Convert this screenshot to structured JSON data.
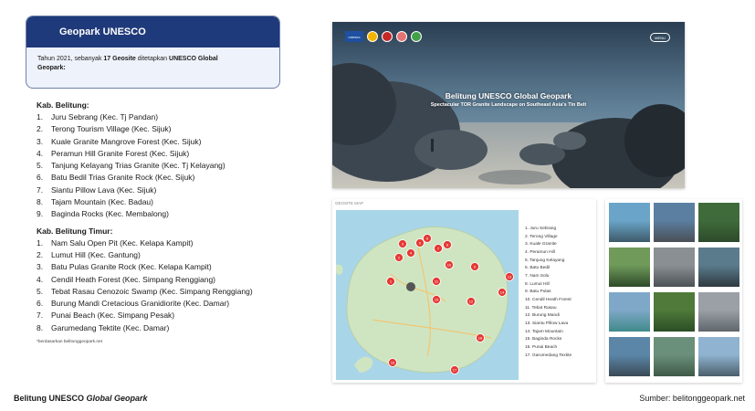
{
  "info_card": {
    "title": "Geopark UNESCO",
    "text_prefix": "Tahun 2021, sebanyak ",
    "text_bold_count": "17 Geosite",
    "text_mid": " ditetapkan ",
    "text_bold_org": "UNESCO Global",
    "text_line2": "Geopark:"
  },
  "groups": [
    {
      "title": "Kab. Belitung:",
      "items": [
        {
          "num": "1.",
          "label": "Juru Sebrang (Kec. Tj Pandan)"
        },
        {
          "num": "2.",
          "label": "Terong Tourism Village (Kec. Sijuk)"
        },
        {
          "num": "3.",
          "label": "Kuale Granite Mangrove Forest (Kec. Sijuk)"
        },
        {
          "num": "4.",
          "label": "Peramun Hill Granite Forest (Kec. Sijuk)"
        },
        {
          "num": "5.",
          "label": "Tanjung Kelayang Trias Granite (Kec. Tj Kelayang)"
        },
        {
          "num": "6.",
          "label": "Batu Bedil Trias Granite Rock (Kec. Sijuk)"
        },
        {
          "num": "7.",
          "label": "Siantu Pillow Lava (Kec. Sijuk)"
        },
        {
          "num": "8.",
          "label": "Tajam Mountain (Kec. Badau)"
        },
        {
          "num": "9.",
          "label": "Baginda Rocks (Kec. Membalong)"
        }
      ]
    },
    {
      "title": "Kab. Belitung Timur:",
      "items": [
        {
          "num": "1.",
          "label": "Nam Salu Open Pit (Kec. Kelapa Kampit)"
        },
        {
          "num": "2.",
          "label": "Lumut Hill (Kec. Gantung)"
        },
        {
          "num": "3.",
          "label": "Batu Pulas Granite Rock (Kec. Kelapa Kampit)"
        },
        {
          "num": "4.",
          "label": "Cendil Heath Forest (Kec. Simpang Renggiang)"
        },
        {
          "num": "5.",
          "label": "Tebat Rasau Cenozoic Swamp (Kec. Simpang Renggiang)"
        },
        {
          "num": "6.",
          "label": "Burung Mandi Cretacious Granidiorite (Kec. Damar)"
        },
        {
          "num": "7.",
          "label": "Punai Beach (Kec. Simpang Pesak)"
        },
        {
          "num": "8.",
          "label": "Garumedang Tektite (Kec. Damar)"
        }
      ]
    }
  ],
  "footnote": "*berdasarkan belitonggeopark.net",
  "caption_left_prefix": "Belitung UNESCO ",
  "caption_left_italic": "Global Geopark",
  "caption_right": "Sumber: belitonggeopark.net",
  "hero": {
    "title": "Belitung UNESCO Global Geopark",
    "subtitle": "Spectacular TOR Granite Landscape on Southeast Asia's Tin Belt",
    "logo_text": "unesco",
    "menu_text": "MENU"
  },
  "map": {
    "label": "GEOSITE MAP",
    "legend": [
      "1. Juru Sebrang",
      "2. Terong Village",
      "3. Kuale Granite",
      "4. Peramun Hill",
      "5. Tanjung Kelayang",
      "6. Batu Bedil",
      "7. Nam Solu",
      "8. Lumut Hill",
      "9. Batu Pulas",
      "10. Cendil Heath Forest",
      "11. Tebat Rasau",
      "12. Burung Mandi",
      "13. Siantu Pillow Lava",
      "14. Tajam Mountain",
      "15. Baginda Rocks",
      "16. Punai Beach",
      "17. Garumedang Textite"
    ],
    "pins": [
      "1",
      "2",
      "3",
      "4",
      "5",
      "6",
      "7",
      "8",
      "9",
      "10",
      "11",
      "12",
      "13",
      "14",
      "15",
      "16",
      "17",
      "18"
    ]
  },
  "colors": {
    "accent": "#1f3a7a",
    "card_bg": "#eef2fa",
    "sea": "#a8d5e8",
    "land": "#cfe5c2",
    "pin": "#e53935"
  }
}
